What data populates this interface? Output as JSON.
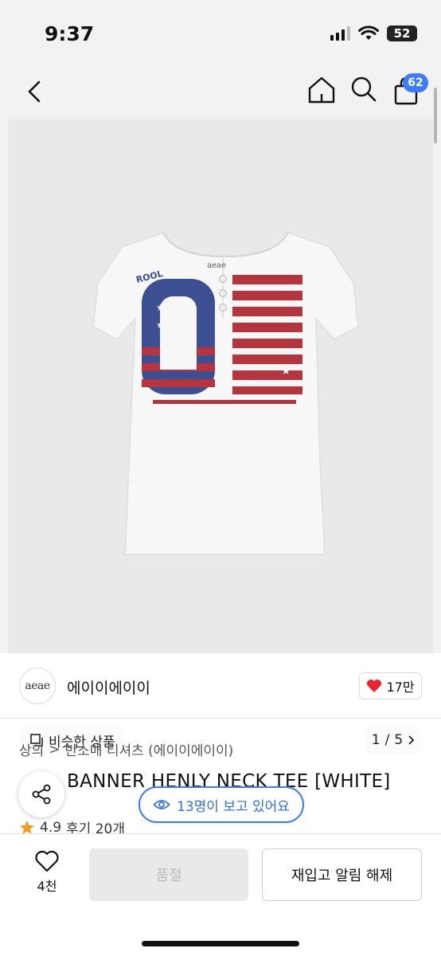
{
  "status_bar": {
    "time": "9:37",
    "battery": "52"
  },
  "nav": {
    "cart_count": "62"
  },
  "gallery": {
    "similar_label": "비슷한 상품",
    "page_current": "1",
    "page_separator": "/",
    "page_total": "5",
    "shirt_print": {
      "collar_logo": "aeae",
      "sleeve_text": "ROOL"
    }
  },
  "brand": {
    "logo_text": "aeae",
    "name": "에이이에이이",
    "likes": "17만"
  },
  "breadcrumb": {
    "category": "상의",
    "separator": ">",
    "subcategory": "반소매 티셔츠 (에이이에이이)"
  },
  "product": {
    "title": "BANNER HENLY NECK TEE [WHITE]",
    "rating": "4.9",
    "reviews": "후기 20개"
  },
  "viewers": "13명이 보고 있어요",
  "bottom_bar": {
    "wish_count": "4천",
    "soldout_label": "품절",
    "restock_label": "재입고 알림 해제"
  },
  "colors": {
    "accent": "#3d7bf7",
    "heart": "#e8242c",
    "star": "#f39c1f",
    "flag_red": "#b5343d",
    "flag_blue": "#3b4f91"
  }
}
